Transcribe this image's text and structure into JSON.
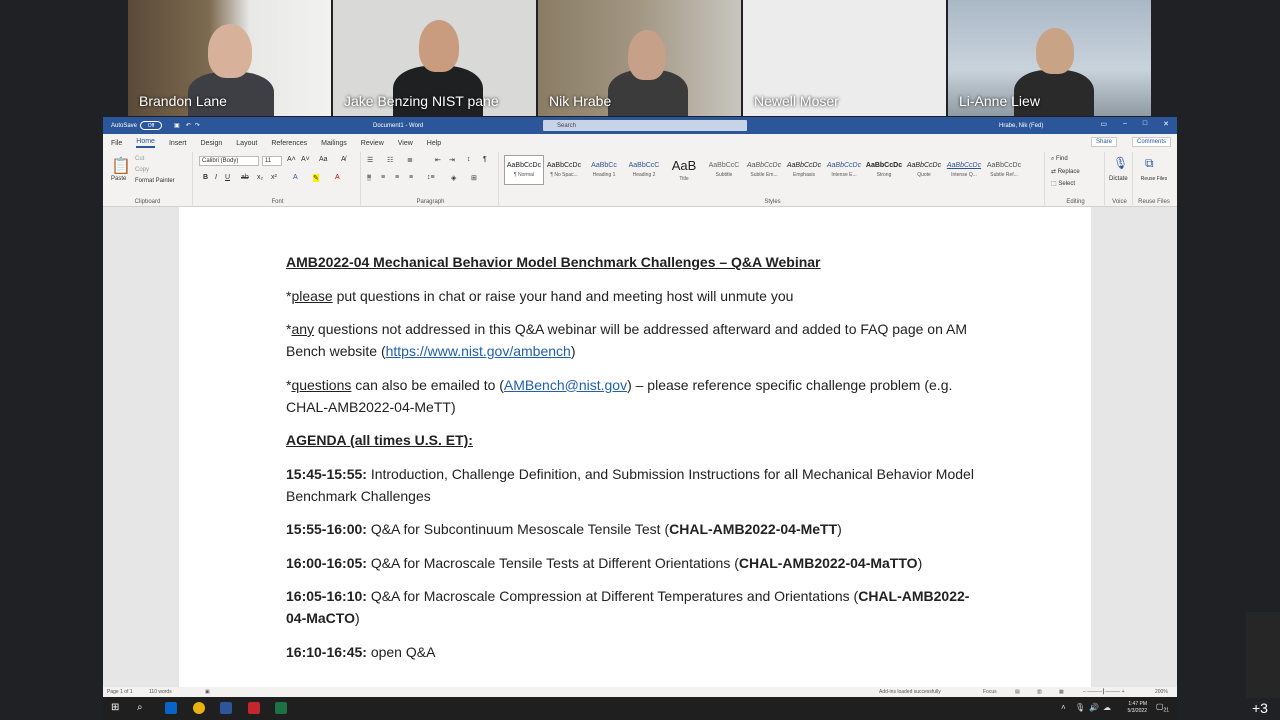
{
  "participants": [
    {
      "name": "Brandon Lane",
      "bg": "#6b5a44",
      "skin": "#d7b19a",
      "shirt": "#3d3f44"
    },
    {
      "name": "Jake Benzing NIST pane",
      "bg": "#d9dad7",
      "skin": "#c99c80",
      "shirt": "#1f2022"
    },
    {
      "name": "Nik Hrabe",
      "bg": "#9c8f7a",
      "skin": "#c7a089",
      "shirt": "#3b3b3b"
    },
    {
      "name": "Newell Moser",
      "bg": "#ececec",
      "skin": "",
      "shirt": ""
    },
    {
      "name": "Li-Anne Liew",
      "bg": "#b7c3ce",
      "skin": "#c8a385",
      "shirt": "#2a2a2a"
    }
  ],
  "word": {
    "autosave_label": "AutoSave",
    "autosave_state": "Off",
    "doc_title": "Document1 - Word",
    "search_placeholder": "Search",
    "user_name": "Hrabe, Nik (Fed)",
    "tabs": [
      "File",
      "Home",
      "Insert",
      "Design",
      "Layout",
      "References",
      "Mailings",
      "Review",
      "View",
      "Help"
    ],
    "active_tab": "Home",
    "share_label": "Share",
    "comments_label": "Comments",
    "ribbon": {
      "clipboard": {
        "label": "Clipboard",
        "paste": "Paste",
        "cut": "Cut",
        "copy": "Copy",
        "format_painter": "Format Painter"
      },
      "font": {
        "label": "Font",
        "font_name": "Calibri (Body)",
        "font_size": "11"
      },
      "paragraph": {
        "label": "Paragraph"
      },
      "styles": {
        "label": "Styles",
        "items": [
          {
            "sample": "AaBbCcDc",
            "label": "¶ Normal"
          },
          {
            "sample": "AaBbCcDc",
            "label": "¶ No Spac..."
          },
          {
            "sample": "AaBbCc",
            "label": "Heading 1"
          },
          {
            "sample": "AaBbCcC",
            "label": "Heading 2"
          },
          {
            "sample": "AaB",
            "label": "Title"
          },
          {
            "sample": "AaBbCcC",
            "label": "Subtitle"
          },
          {
            "sample": "AaBbCcDc",
            "label": "Subtle Em..."
          },
          {
            "sample": "AaBbCcDc",
            "label": "Emphasis"
          },
          {
            "sample": "AaBbCcDc",
            "label": "Intense E..."
          },
          {
            "sample": "AaBbCcDc",
            "label": "Strong"
          },
          {
            "sample": "AaBbCcDc",
            "label": "Quote"
          },
          {
            "sample": "AaBbCcDc",
            "label": "Intense Q..."
          },
          {
            "sample": "AaBbCcDc",
            "label": "Subtle Ref..."
          }
        ]
      },
      "editing": {
        "label": "Editing",
        "find": "Find",
        "replace": "Replace",
        "select": "Select"
      },
      "voice": {
        "label": "Voice",
        "dictate": "Dictate"
      },
      "reuse": {
        "label": "Reuse Files",
        "reuse_files": "Reuse Files"
      }
    },
    "document": {
      "title": "AMB2022-04 Mechanical Behavior Model Benchmark Challenges – Q&A Webinar",
      "p1_star": "*",
      "p1_u": "please",
      "p1_rest": " put questions in chat or raise your hand and meeting host will unmute you",
      "p2_star": "*",
      "p2_u": "any",
      "p2_rest": " questions not addressed in this Q&A webinar will be addressed afterward and added to FAQ page on AM Bench website (",
      "p2_link": "https://www.nist.gov/ambench",
      "p2_end": ")",
      "p3_star": "*",
      "p3_u": "questions",
      "p3_rest": " can also be emailed to (",
      "p3_link": "AMBench@nist.gov",
      "p3_end": ") – please reference specific challenge problem (e.g. CHAL-AMB2022-04-MeTT)",
      "agenda_heading": "AGENDA (all times U.S. ET):",
      "agenda": [
        {
          "time": "15:45-15:55:",
          "text": " Introduction, Challenge Definition, and Submission Instructions for all Mechanical Behavior Model Benchmark Challenges",
          "code": "",
          "end": ""
        },
        {
          "time": "15:55-16:00:",
          "text": " Q&A for Subcontinuum Mesoscale Tensile Test (",
          "code": "CHAL-AMB2022-04-MeTT",
          "end": ")"
        },
        {
          "time": "16:00-16:05:",
          "text": " Q&A for Macroscale Tensile Tests at Different Orientations (",
          "code": "CHAL-AMB2022-04-MaTTO",
          "end": ")"
        },
        {
          "time": "16:05-16:10:",
          "text": " Q&A for Macroscale Compression at Different Temperatures and Orientations (",
          "code": "CHAL-AMB2022-04-MaCTO",
          "end": ")"
        },
        {
          "time": "16:10-16:45:",
          "text": " open Q&A",
          "code": "",
          "end": ""
        }
      ]
    },
    "status": {
      "page": "Page 1 of 1",
      "words": "110 words",
      "addins": "Add-ins loaded successfully",
      "focus": "Focus",
      "zoom": "200%"
    }
  },
  "taskbar": {
    "time": "1:47 PM",
    "date": "5/3/2022",
    "notif_count": "21"
  },
  "overflow_count": "+3"
}
